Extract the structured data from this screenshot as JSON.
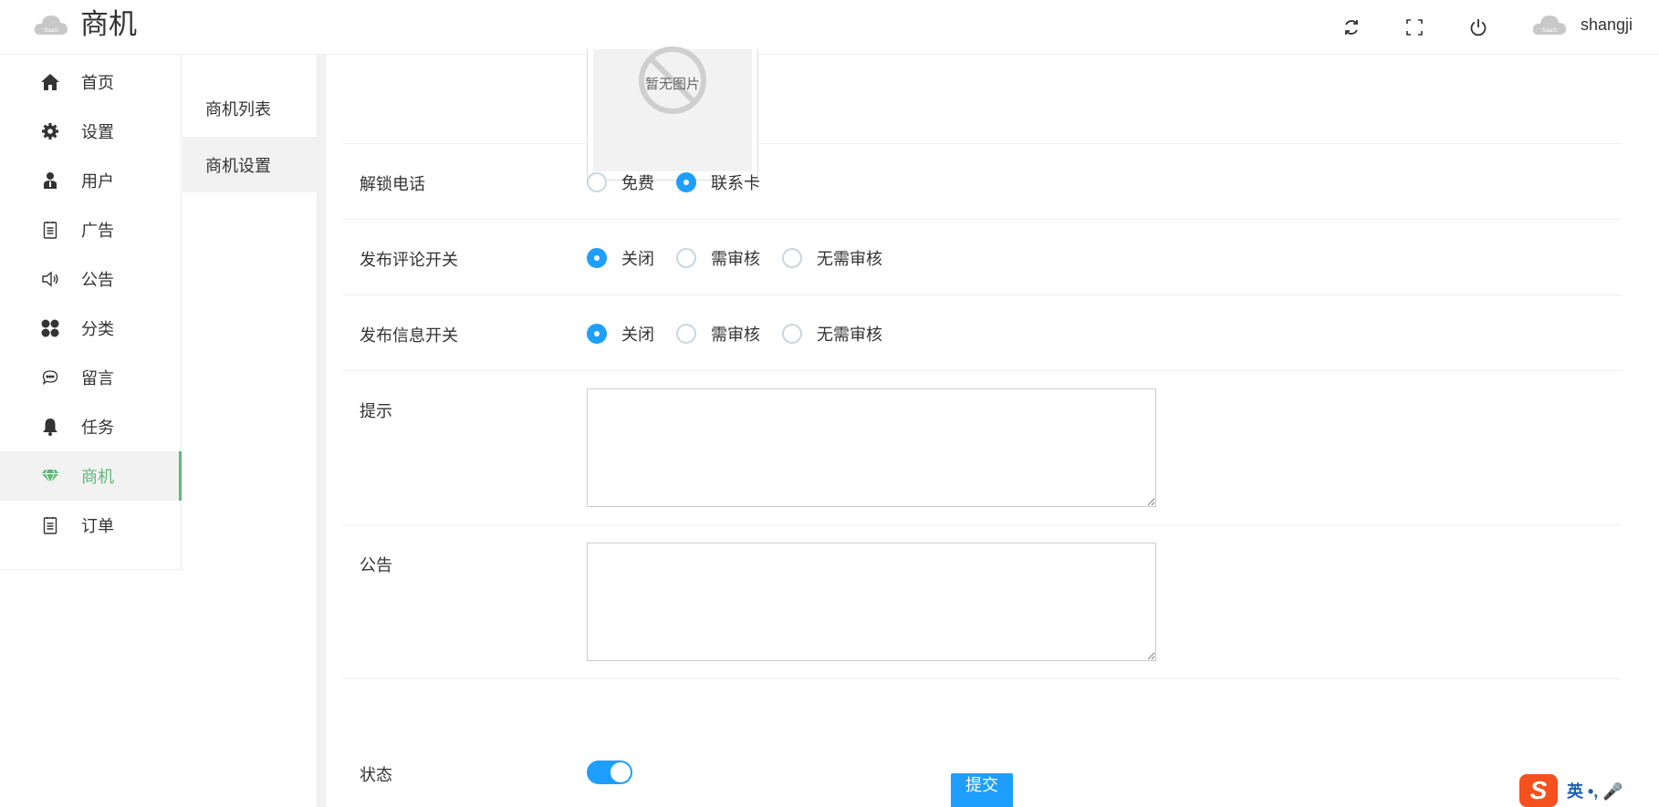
{
  "header": {
    "logo_badge": "SaaS",
    "title": "商机",
    "refresh_icon": "refresh-icon",
    "fullscreen_icon": "fullscreen-icon",
    "power_icon": "power-icon",
    "avatar_badge": "SaaS",
    "username": "shangji"
  },
  "sidebar": {
    "items": [
      {
        "label": "首页",
        "icon": "home-icon"
      },
      {
        "label": "设置",
        "icon": "gear-icon"
      },
      {
        "label": "用户",
        "icon": "user-icon"
      },
      {
        "label": "广告",
        "icon": "document-icon"
      },
      {
        "label": "公告",
        "icon": "speaker-icon"
      },
      {
        "label": "分类",
        "icon": "category-icon"
      },
      {
        "label": "留言",
        "icon": "chat-icon"
      },
      {
        "label": "任务",
        "icon": "bell-icon"
      },
      {
        "label": "商机",
        "icon": "diamond-icon",
        "active": true
      },
      {
        "label": "订单",
        "icon": "document-icon"
      }
    ]
  },
  "subnav": {
    "items": [
      {
        "label": "商机列表"
      },
      {
        "label": "商机设置",
        "active": true
      }
    ]
  },
  "form": {
    "image_placeholder": "暂无图片",
    "unlock_phone": {
      "label": "解锁电话",
      "options": [
        "免费",
        "联系卡"
      ],
      "selected": "联系卡"
    },
    "comment_switch": {
      "label": "发布评论开关",
      "options": [
        "关闭",
        "需审核",
        "无需审核"
      ],
      "selected": "关闭"
    },
    "info_switch": {
      "label": "发布信息开关",
      "options": [
        "关闭",
        "需审核",
        "无需审核"
      ],
      "selected": "关闭"
    },
    "tip": {
      "label": "提示",
      "value": ""
    },
    "notice": {
      "label": "公告",
      "value": ""
    },
    "status": {
      "label": "状态",
      "on": true
    },
    "submit_label": "提交"
  },
  "ime": {
    "logo": "S",
    "text": "英 •, 🎤"
  },
  "colors": {
    "accent_blue": "#1e9fff",
    "active_green": "#5fb878"
  }
}
